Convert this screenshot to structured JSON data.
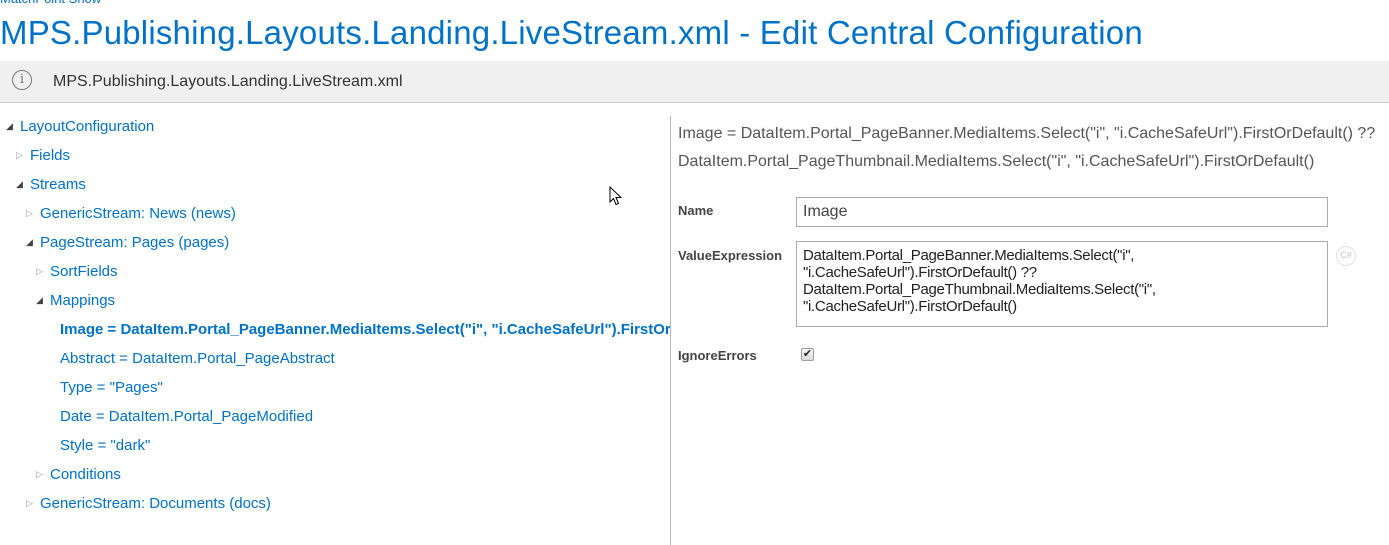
{
  "header": {
    "site_name": "MatchPoint Show",
    "title": "MPS.Publishing.Layouts.Landing.LiveStream.xml - Edit Central Configuration"
  },
  "info_bar": {
    "icon": "info-icon",
    "text": "MPS.Publishing.Layouts.Landing.LiveStream.xml"
  },
  "tree": {
    "nodes": [
      {
        "label": "LayoutConfiguration",
        "level": 0,
        "state": "expanded"
      },
      {
        "label": "Fields",
        "level": 1,
        "state": "collapsed"
      },
      {
        "label": "Streams",
        "level": 1,
        "state": "expanded"
      },
      {
        "label": "GenericStream: News (news)",
        "level": 2,
        "state": "collapsed"
      },
      {
        "label": "PageStream: Pages (pages)",
        "level": 2,
        "state": "expanded"
      },
      {
        "label": "SortFields",
        "level": 3,
        "state": "collapsed"
      },
      {
        "label": "Mappings",
        "level": 3,
        "state": "expanded"
      },
      {
        "label": "Image = DataItem.Portal_PageBanner.MediaItems.Select(\"i\", \"i.CacheSafeUrl\").FirstOrDefault() ?? DataItem.Portal_PageThumbnail.MediaItems.Select(\"i\", \"i.CacheSafeUrl\").FirstOrDefault()",
        "level": 4,
        "state": "leaf",
        "selected": true
      },
      {
        "label": "Abstract = DataItem.Portal_PageAbstract",
        "level": 4,
        "state": "leaf"
      },
      {
        "label": "Type = \"Pages\"",
        "level": 4,
        "state": "leaf"
      },
      {
        "label": "Date = DataItem.Portal_PageModified",
        "level": 4,
        "state": "leaf"
      },
      {
        "label": "Style = \"dark\"",
        "level": 4,
        "state": "leaf"
      },
      {
        "label": "Conditions",
        "level": 3,
        "state": "collapsed"
      },
      {
        "label": "GenericStream: Documents (docs)",
        "level": 2,
        "state": "collapsed"
      }
    ]
  },
  "detail": {
    "summary_line1": "Image = DataItem.Portal_PageBanner.MediaItems.Select(\"i\", \"i.CacheSafeUrl\").FirstOrDefault() ??",
    "summary_line2": "DataItem.Portal_PageThumbnail.MediaItems.Select(\"i\", \"i.CacheSafeUrl\").FirstOrDefault()",
    "fields": {
      "name": {
        "label": "Name",
        "value": "Image"
      },
      "value_expression": {
        "label": "ValueExpression",
        "value": "DataItem.Portal_PageBanner.MediaItems.Select(\"i\", \"i.CacheSafeUrl\").FirstOrDefault() ?? DataItem.Portal_PageThumbnail.MediaItems.Select(\"i\", \"i.CacheSafeUrl\").FirstOrDefault()",
        "editor_button": "C#"
      },
      "ignore_errors": {
        "label": "IgnoreErrors",
        "checked": true,
        "check_glyph": "✔"
      }
    }
  },
  "colors": {
    "accent": "#0072c6",
    "info_bar_bg": "#f0f0f0",
    "label": "#444444"
  }
}
